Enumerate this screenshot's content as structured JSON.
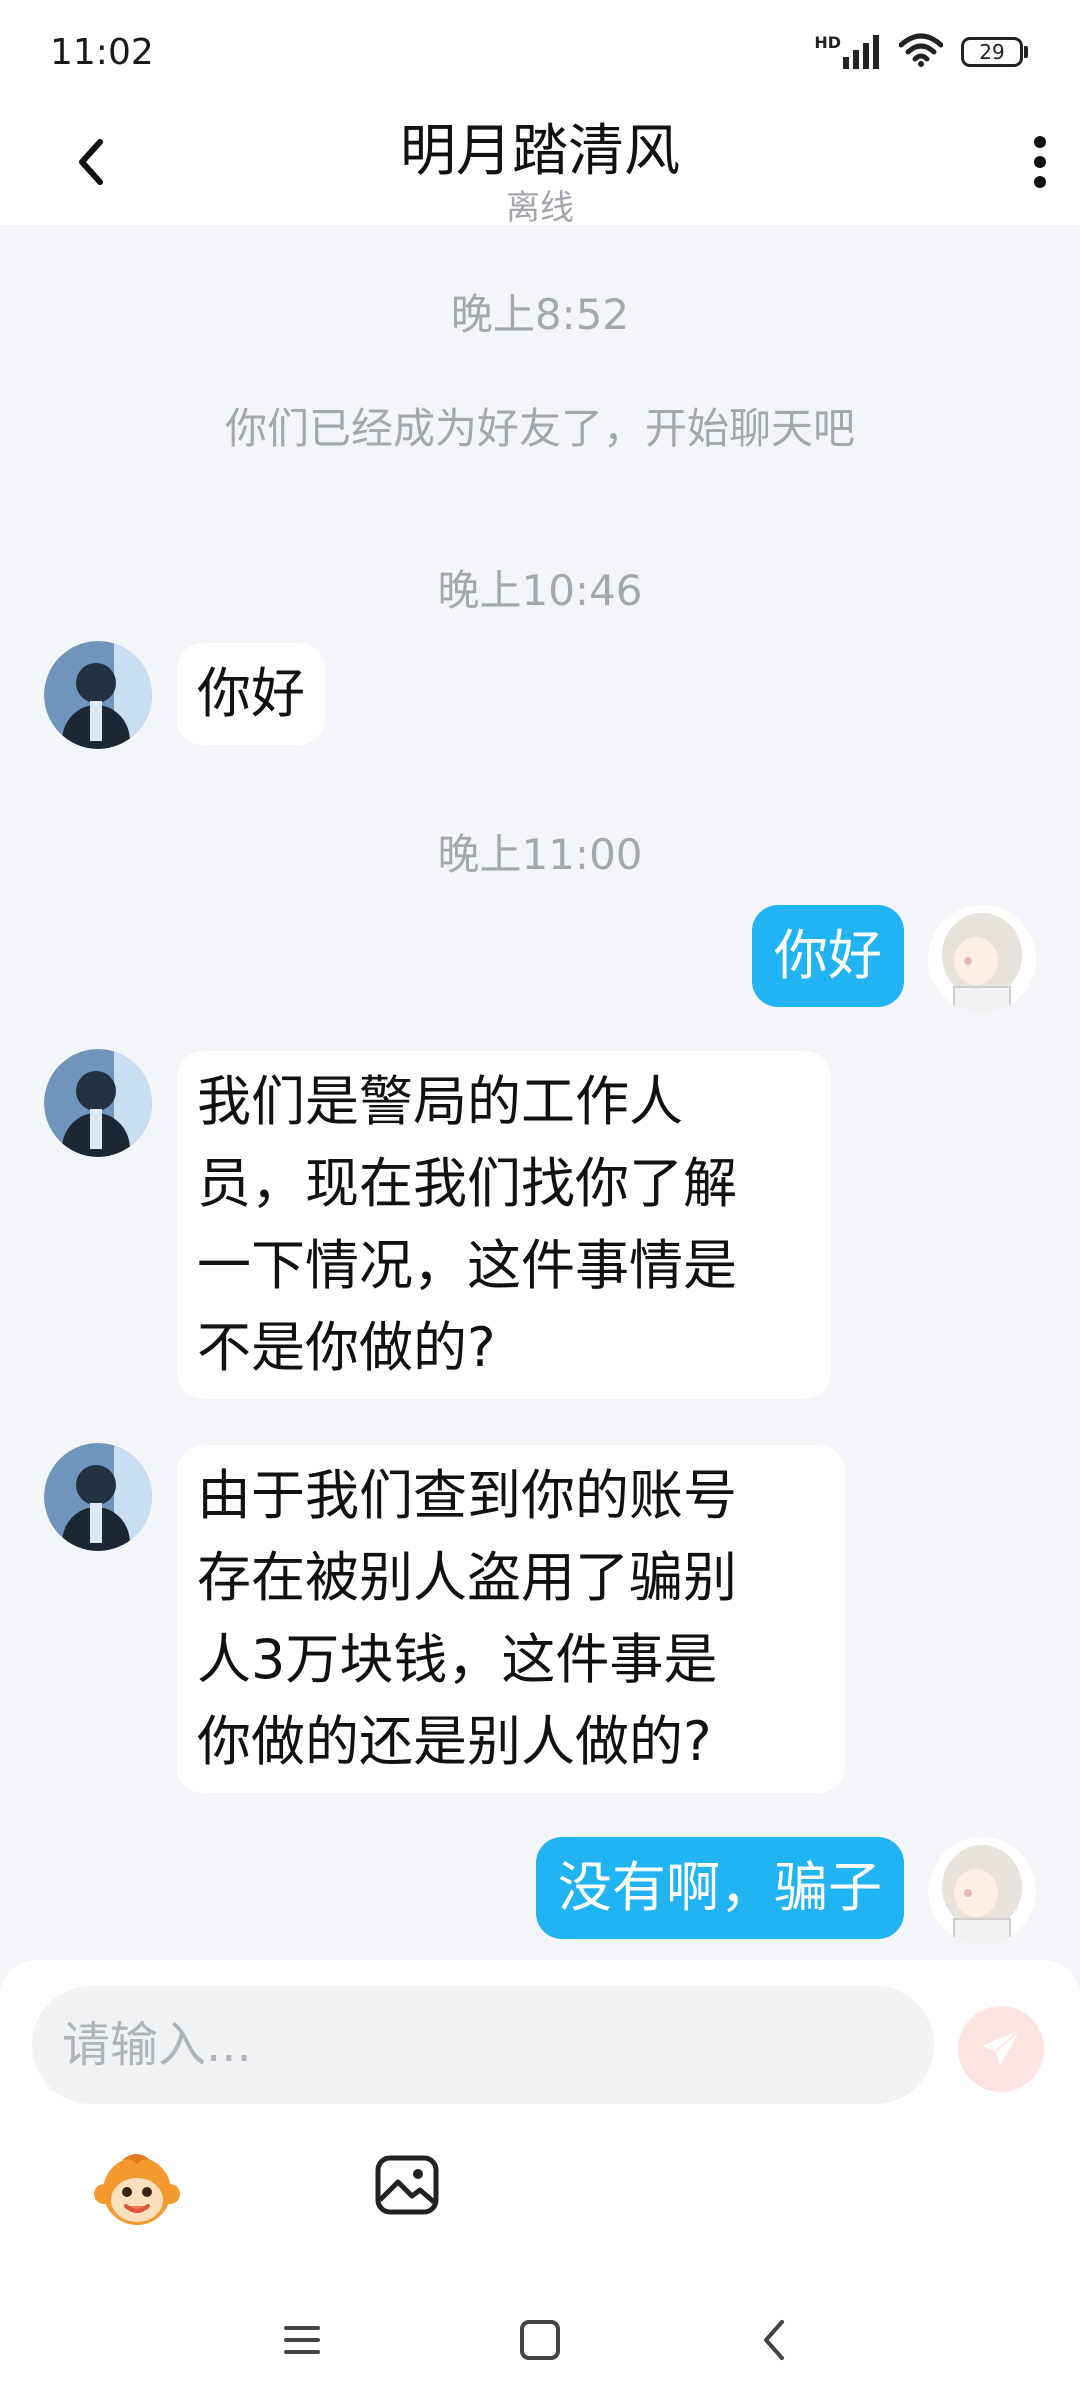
{
  "status_bar": {
    "time": "11:02",
    "network_label": "HD",
    "battery": "29"
  },
  "header": {
    "title": "明月踏清风",
    "subtitle": "离线"
  },
  "chat": {
    "time_1": "晚上8:52",
    "system_message": "你们已经成为好友了，开始聊天吧",
    "time_2": "晚上10:46",
    "msg_1": "你好",
    "time_3": "晚上11:00",
    "msg_2": "你好",
    "msg_3_line_1": "我们是警局的工作人",
    "msg_3_line_2": "员，现在我们找你了解",
    "msg_3_line_3": "一下情况，这件事情是",
    "msg_3_line_4": "不是你做的?",
    "msg_4_line_1": "由于我们查到你的账号",
    "msg_4_line_2": "存在被别人盗用了骗别",
    "msg_4_line_3": "人3万块钱，这件事是",
    "msg_4_line_4": "你做的还是别人做的?",
    "msg_5": "没有啊，骗子"
  },
  "composer": {
    "placeholder": "请输入..."
  },
  "icons": {
    "back": "chevron-left-icon",
    "more": "more-vertical-icon",
    "send": "send-icon",
    "emoji": "emoji-monkey-icon",
    "image": "image-icon",
    "nav_menu": "menu-icon",
    "nav_home": "home-square-icon",
    "nav_back": "back-icon"
  },
  "colors": {
    "chat_background": "#f3f5f8",
    "outgoing_bubble": "#22b3f2",
    "incoming_bubble": "#ffffff",
    "send_button_disabled": "#fde3e1"
  }
}
